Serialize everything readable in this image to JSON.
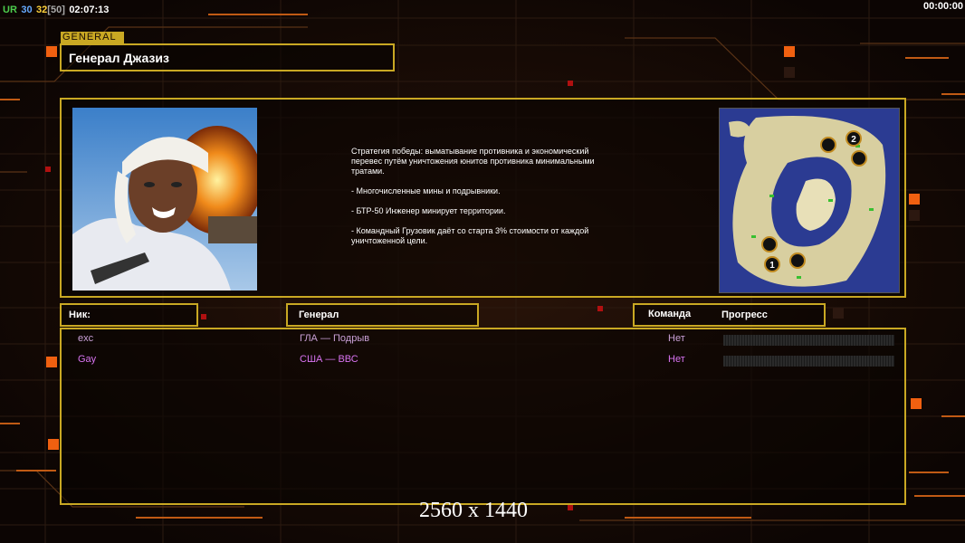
{
  "hud": {
    "ur_label": "UR",
    "val1": "30",
    "val2": "32",
    "bracket": "[50]",
    "clock": "02:07:13",
    "timer": "00:00:00"
  },
  "general": {
    "tag": "GENERAL",
    "name": "Генерал Джазиз"
  },
  "description": [
    "Стратегия победы: выматывание противника и экономический\n перевес путём уничтожения юнитов противника минимальными\n тратами.",
    "- Многочисленные мины и подрывники.",
    "- БТР-50 Инженер минирует территории.",
    "- Командный Грузовик даёт со старта 3% стоимости от каждой\n уничтоженной цели."
  ],
  "headers": {
    "nick": "Ник:",
    "general": "Генерал",
    "team": "Команда",
    "progress": "Прогресс"
  },
  "players": [
    {
      "nick": "exc",
      "general": "ГЛА — Подрыв",
      "team": "Нет",
      "color": "#c9a0d6"
    },
    {
      "nick": "Gay",
      "general": "США — ВВС",
      "team": "Нет",
      "color": "#d873f0"
    }
  ],
  "map": {
    "start_labels": [
      "2",
      "1"
    ]
  },
  "resolution": "2560 x 1440",
  "colors": {
    "frame": "#c9a823",
    "ur": "#4ccc4c",
    "val1": "#66aaff",
    "val2": "#ffd23c",
    "bracket": "#aaaaaa"
  }
}
